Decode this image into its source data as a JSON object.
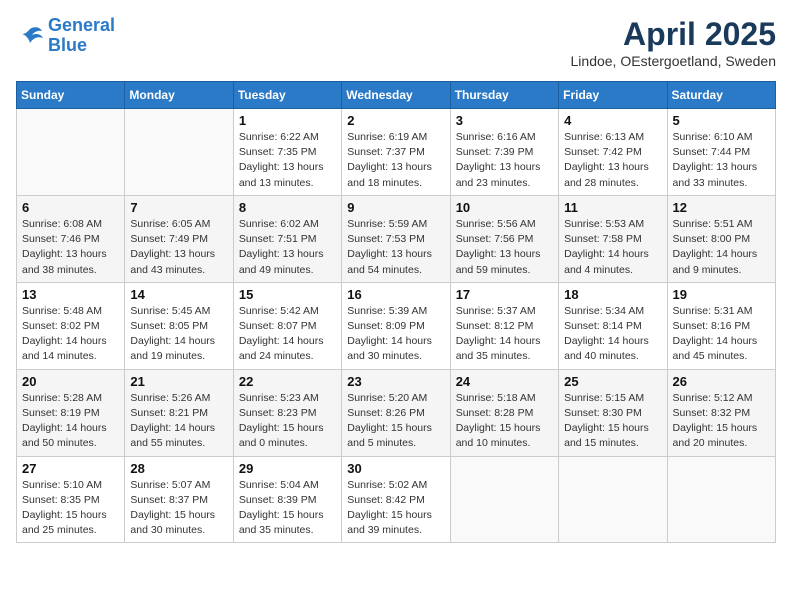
{
  "header": {
    "logo_general": "General",
    "logo_blue": "Blue",
    "month_title": "April 2025",
    "location": "Lindoe, OEstergoetland, Sweden"
  },
  "days_of_week": [
    "Sunday",
    "Monday",
    "Tuesday",
    "Wednesday",
    "Thursday",
    "Friday",
    "Saturday"
  ],
  "weeks": [
    [
      {
        "num": "",
        "info": ""
      },
      {
        "num": "",
        "info": ""
      },
      {
        "num": "1",
        "info": "Sunrise: 6:22 AM\nSunset: 7:35 PM\nDaylight: 13 hours and 13 minutes."
      },
      {
        "num": "2",
        "info": "Sunrise: 6:19 AM\nSunset: 7:37 PM\nDaylight: 13 hours and 18 minutes."
      },
      {
        "num": "3",
        "info": "Sunrise: 6:16 AM\nSunset: 7:39 PM\nDaylight: 13 hours and 23 minutes."
      },
      {
        "num": "4",
        "info": "Sunrise: 6:13 AM\nSunset: 7:42 PM\nDaylight: 13 hours and 28 minutes."
      },
      {
        "num": "5",
        "info": "Sunrise: 6:10 AM\nSunset: 7:44 PM\nDaylight: 13 hours and 33 minutes."
      }
    ],
    [
      {
        "num": "6",
        "info": "Sunrise: 6:08 AM\nSunset: 7:46 PM\nDaylight: 13 hours and 38 minutes."
      },
      {
        "num": "7",
        "info": "Sunrise: 6:05 AM\nSunset: 7:49 PM\nDaylight: 13 hours and 43 minutes."
      },
      {
        "num": "8",
        "info": "Sunrise: 6:02 AM\nSunset: 7:51 PM\nDaylight: 13 hours and 49 minutes."
      },
      {
        "num": "9",
        "info": "Sunrise: 5:59 AM\nSunset: 7:53 PM\nDaylight: 13 hours and 54 minutes."
      },
      {
        "num": "10",
        "info": "Sunrise: 5:56 AM\nSunset: 7:56 PM\nDaylight: 13 hours and 59 minutes."
      },
      {
        "num": "11",
        "info": "Sunrise: 5:53 AM\nSunset: 7:58 PM\nDaylight: 14 hours and 4 minutes."
      },
      {
        "num": "12",
        "info": "Sunrise: 5:51 AM\nSunset: 8:00 PM\nDaylight: 14 hours and 9 minutes."
      }
    ],
    [
      {
        "num": "13",
        "info": "Sunrise: 5:48 AM\nSunset: 8:02 PM\nDaylight: 14 hours and 14 minutes."
      },
      {
        "num": "14",
        "info": "Sunrise: 5:45 AM\nSunset: 8:05 PM\nDaylight: 14 hours and 19 minutes."
      },
      {
        "num": "15",
        "info": "Sunrise: 5:42 AM\nSunset: 8:07 PM\nDaylight: 14 hours and 24 minutes."
      },
      {
        "num": "16",
        "info": "Sunrise: 5:39 AM\nSunset: 8:09 PM\nDaylight: 14 hours and 30 minutes."
      },
      {
        "num": "17",
        "info": "Sunrise: 5:37 AM\nSunset: 8:12 PM\nDaylight: 14 hours and 35 minutes."
      },
      {
        "num": "18",
        "info": "Sunrise: 5:34 AM\nSunset: 8:14 PM\nDaylight: 14 hours and 40 minutes."
      },
      {
        "num": "19",
        "info": "Sunrise: 5:31 AM\nSunset: 8:16 PM\nDaylight: 14 hours and 45 minutes."
      }
    ],
    [
      {
        "num": "20",
        "info": "Sunrise: 5:28 AM\nSunset: 8:19 PM\nDaylight: 14 hours and 50 minutes."
      },
      {
        "num": "21",
        "info": "Sunrise: 5:26 AM\nSunset: 8:21 PM\nDaylight: 14 hours and 55 minutes."
      },
      {
        "num": "22",
        "info": "Sunrise: 5:23 AM\nSunset: 8:23 PM\nDaylight: 15 hours and 0 minutes."
      },
      {
        "num": "23",
        "info": "Sunrise: 5:20 AM\nSunset: 8:26 PM\nDaylight: 15 hours and 5 minutes."
      },
      {
        "num": "24",
        "info": "Sunrise: 5:18 AM\nSunset: 8:28 PM\nDaylight: 15 hours and 10 minutes."
      },
      {
        "num": "25",
        "info": "Sunrise: 5:15 AM\nSunset: 8:30 PM\nDaylight: 15 hours and 15 minutes."
      },
      {
        "num": "26",
        "info": "Sunrise: 5:12 AM\nSunset: 8:32 PM\nDaylight: 15 hours and 20 minutes."
      }
    ],
    [
      {
        "num": "27",
        "info": "Sunrise: 5:10 AM\nSunset: 8:35 PM\nDaylight: 15 hours and 25 minutes."
      },
      {
        "num": "28",
        "info": "Sunrise: 5:07 AM\nSunset: 8:37 PM\nDaylight: 15 hours and 30 minutes."
      },
      {
        "num": "29",
        "info": "Sunrise: 5:04 AM\nSunset: 8:39 PM\nDaylight: 15 hours and 35 minutes."
      },
      {
        "num": "30",
        "info": "Sunrise: 5:02 AM\nSunset: 8:42 PM\nDaylight: 15 hours and 39 minutes."
      },
      {
        "num": "",
        "info": ""
      },
      {
        "num": "",
        "info": ""
      },
      {
        "num": "",
        "info": ""
      }
    ]
  ]
}
